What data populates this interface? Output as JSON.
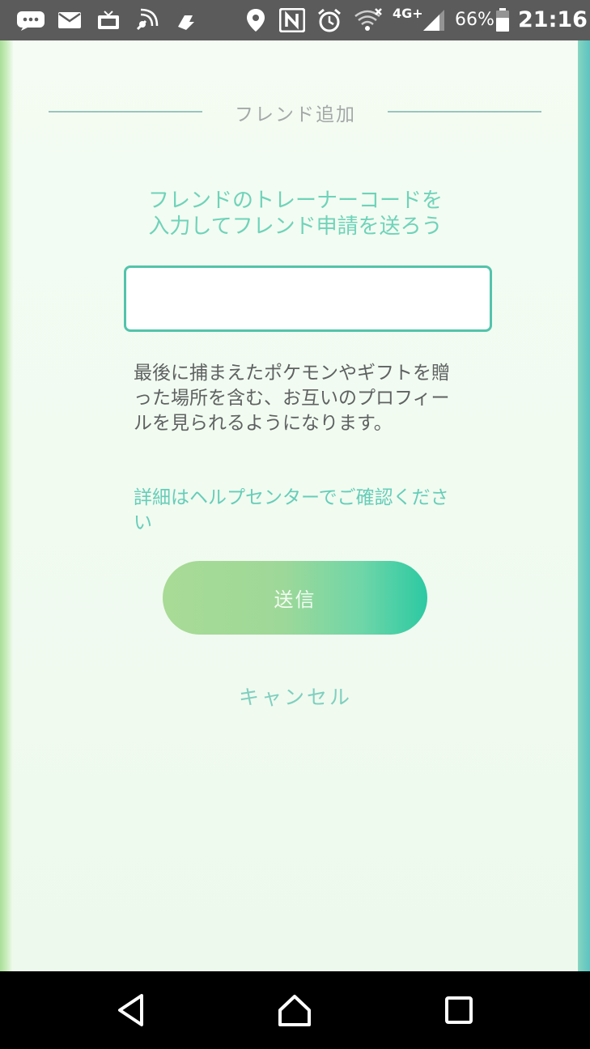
{
  "status_bar": {
    "icons": [
      "chat-icon",
      "mail-icon",
      "tv-icon",
      "satellite-icon",
      "pokemon-go-plus-icon",
      "location-icon",
      "nfc-icon",
      "alarm-icon",
      "wifi-off-icon",
      "signal-icon",
      "battery-icon"
    ],
    "network": "4G+",
    "battery_percent": "66%",
    "time": "21:16"
  },
  "dialog": {
    "title": "フレンド追加",
    "prompt_line1": "フレンドのトレーナーコードを",
    "prompt_line2": "入力してフレンド申請を送ろう",
    "code_input_value": "",
    "description": "最後に捕まえたポケモンやギフトを贈った場所を含む、お互いのプロフィールを見られるようになります。",
    "help_link": "詳細はヘルプセンターでご確認ください",
    "send_label": "送信",
    "cancel_label": "キャンセル"
  },
  "colors": {
    "accent": "#52c4ab",
    "prompt": "#6ed3b9",
    "button_start": "#a8db96",
    "button_end": "#2cc9a3"
  },
  "nav_bar": {
    "buttons": [
      "back-icon",
      "home-icon",
      "recents-icon"
    ]
  }
}
